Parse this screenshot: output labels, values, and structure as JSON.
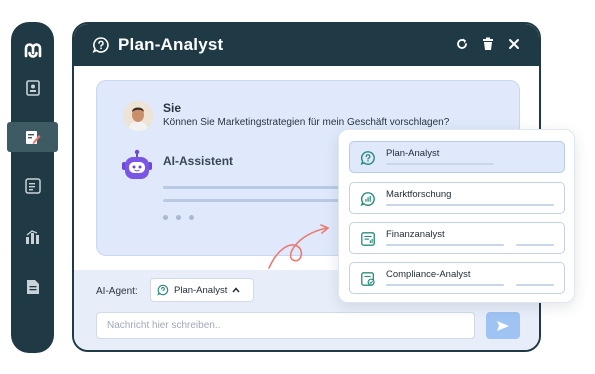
{
  "sidebar": {
    "items": [
      {
        "icon": "logo-icon"
      },
      {
        "icon": "contacts-book-icon"
      },
      {
        "icon": "edit-document-icon",
        "active": true
      },
      {
        "icon": "receipt-list-icon"
      },
      {
        "icon": "chart-icon"
      },
      {
        "icon": "document-icon"
      }
    ]
  },
  "window": {
    "title": "Plan-Analyst",
    "title_icon": "chat-question-icon",
    "actions": [
      "refresh-icon",
      "trash-icon",
      "close-icon"
    ]
  },
  "chat": {
    "user_name": "Sie",
    "user_message": "Können Sie Marketingstrategien für mein Geschäft vorschlagen?",
    "assistant_name": "AI-Assistent"
  },
  "composer": {
    "agent_label": "AI-Agent:",
    "agent_selected": "Plan-Analyst",
    "input_placeholder": "Nachricht hier schreiben..",
    "send_icon": "send-icon"
  },
  "dropdown": {
    "options": [
      {
        "label": "Plan-Analyst",
        "icon": "chat-question-icon",
        "selected": true
      },
      {
        "label": "Marktforschung",
        "icon": "signal-chat-icon",
        "selected": false
      },
      {
        "label": "Finanzanalyst",
        "icon": "finance-doc-icon",
        "selected": false
      },
      {
        "label": "Compliance-Analyst",
        "icon": "compliance-doc-icon",
        "selected": false
      }
    ]
  },
  "colors": {
    "navy": "#1f3a45",
    "accent_coral": "#ea7b73",
    "panel_blue": "#dfe9fb",
    "send_blue": "#9fc4f3",
    "icon_green": "#2b8c7e",
    "bot_purple": "#6c47d9"
  }
}
